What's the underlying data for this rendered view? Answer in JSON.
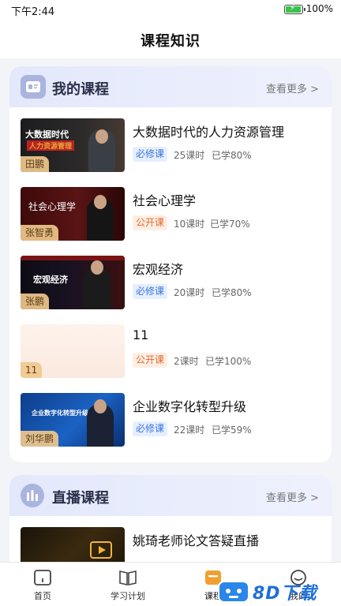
{
  "status_bar": {
    "time": "下午2:44",
    "battery": "100%"
  },
  "header": {
    "title": "课程知识"
  },
  "my_courses": {
    "title": "我的课程",
    "more": "查看更多 >",
    "items": [
      {
        "title": "大数据时代的人力资源管理",
        "type": "必修课",
        "hours": "25课时",
        "progress": "已学80%",
        "teacher": "田鹏",
        "thumb_title": "大数据时代",
        "thumb_subtitle": "人力资源管理",
        "thumb_caption": "田鹏"
      },
      {
        "title": "社会心理学",
        "type": "公开课",
        "hours": "10课时",
        "progress": "已学70%",
        "teacher": "张智勇",
        "thumb_title": "社会心理学"
      },
      {
        "title": "宏观经济",
        "type": "必修课",
        "hours": "20课时",
        "progress": "已学80%",
        "teacher": "张鹏",
        "thumb_title": "宏观经济"
      },
      {
        "title": "11",
        "type": "公开课",
        "hours": "2课时",
        "progress": "已学100%",
        "teacher": "11"
      },
      {
        "title": "企业数字化转型升级",
        "type": "必修课",
        "hours": "22课时",
        "progress": "已学59%",
        "teacher": "刘华鹏",
        "thumb_title": "企业数字化转型升级"
      }
    ]
  },
  "live_courses": {
    "title": "直播课程",
    "more": "查看更多 >",
    "items": [
      {
        "title": "姚琦老师论文答疑直播"
      }
    ]
  },
  "tabbar": {
    "tabs": [
      {
        "label": "首页"
      },
      {
        "label": "学习计划"
      },
      {
        "label": "课程"
      },
      {
        "label": "我的"
      }
    ]
  },
  "watermark": {
    "text": "8D下载"
  },
  "colors": {
    "required_badge": "#3a76d8",
    "public_badge": "#e46b2c",
    "section_header": "#e3e8fb",
    "active_tab": "#f0a030"
  }
}
